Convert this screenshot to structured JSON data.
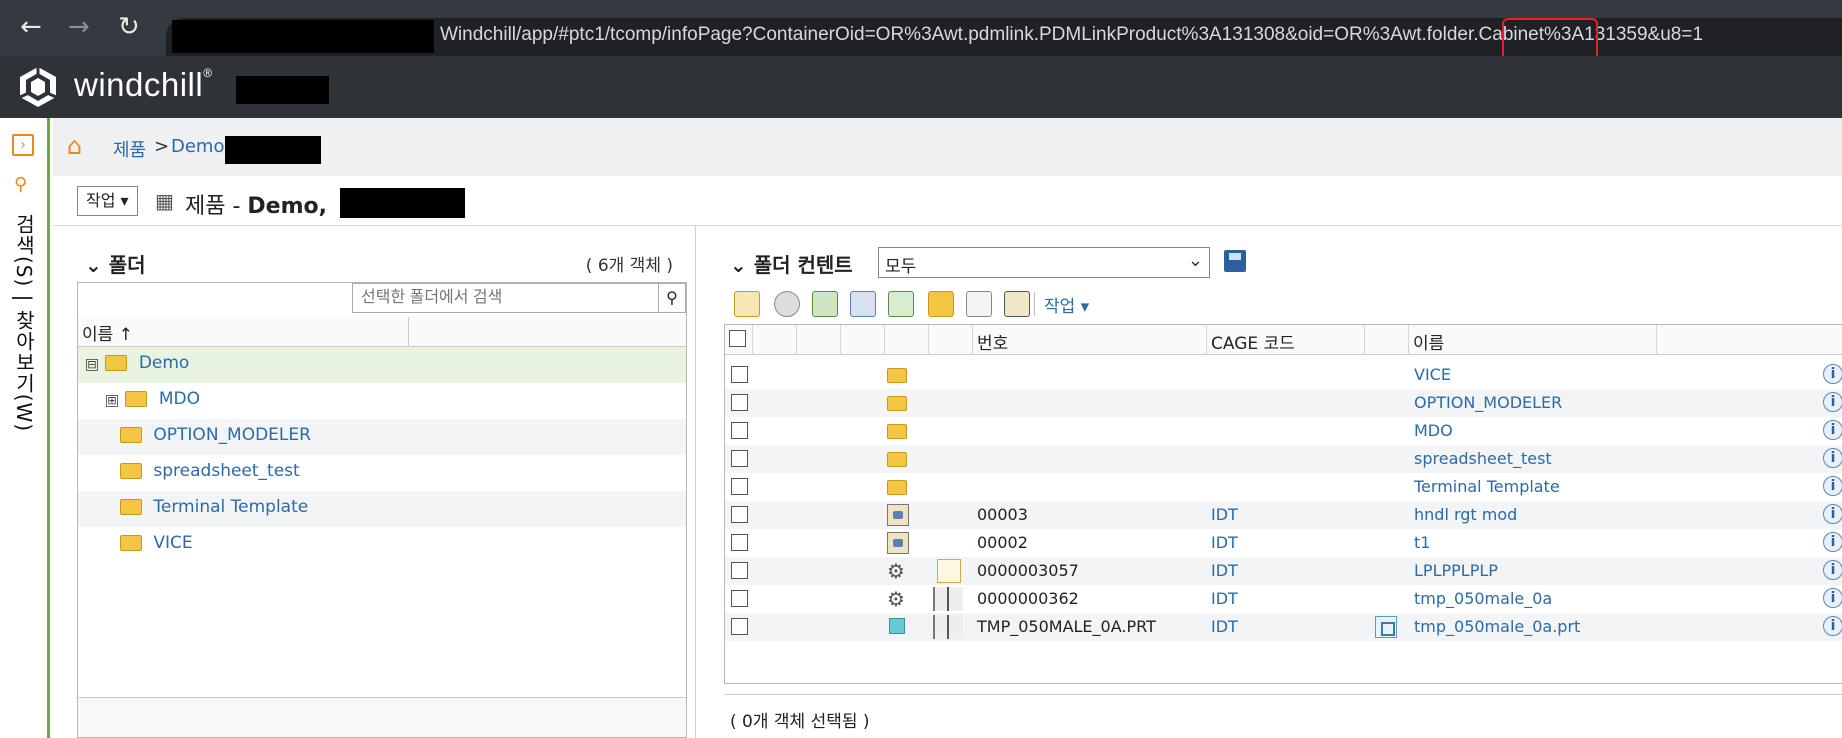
{
  "browser": {
    "back_icon": "arrow-left-icon",
    "forward_icon": "arrow-right-icon",
    "reload_icon": "reload-icon",
    "url_visible": "Windchill/app/#ptc1/tcomp/infoPage?ContainerOid=OR%3Awt.pdmlink.PDMLinkProduct%3A131308&oid=OR%3Awt.folder.Cabinet%3A131359&u8=1"
  },
  "app": {
    "brand": "windchill",
    "brand_mark": "®"
  },
  "left_nav": {
    "vertical_label": "검색(S) | 찾아보기(W)"
  },
  "breadcrumb": {
    "items": [
      "제품",
      "Demo,"
    ],
    "separator": ">"
  },
  "title_row": {
    "action_label": "작업 ▾",
    "title_prefix": "제품 - ",
    "title_bold": "Demo,"
  },
  "tree_panel": {
    "header": "폴더",
    "count": "( 6개 객체 )",
    "search_placeholder": "선택한 폴더에서 검색",
    "column_name": "이름 ↑",
    "rows": [
      {
        "label": "Demo",
        "expander": "⊟"
      },
      {
        "label": "MDO",
        "expander": "⊞"
      },
      {
        "label": "OPTION_MODELER",
        "expander": ""
      },
      {
        "label": "spreadsheet_test",
        "expander": ""
      },
      {
        "label": "Terminal Template",
        "expander": ""
      },
      {
        "label": "VICE",
        "expander": ""
      }
    ]
  },
  "content_panel": {
    "header": "폴더 컨텐트",
    "view_value": "모두",
    "toolbar_actions": "작업 ▾",
    "columns": {
      "number": "번호",
      "cage": "CAGE 코드",
      "name": "이름"
    },
    "rows": [
      {
        "type": "folder",
        "number": "",
        "cage": "",
        "name": "VICE"
      },
      {
        "type": "folder",
        "number": "",
        "cage": "",
        "name": "OPTION_MODELER"
      },
      {
        "type": "folder",
        "number": "",
        "cage": "",
        "name": "MDO"
      },
      {
        "type": "folder",
        "number": "",
        "cage": "",
        "name": "spreadsheet_test"
      },
      {
        "type": "folder",
        "number": "",
        "cage": "",
        "name": "Terminal Template"
      },
      {
        "type": "part",
        "number": "00003",
        "cage": "IDT",
        "name": "hndl rgt mod"
      },
      {
        "type": "part",
        "number": "00002",
        "cage": "IDT",
        "name": "t1"
      },
      {
        "type": "gear-doc",
        "number": "0000003057",
        "cage": "IDT",
        "name": "LPLPPLPLP"
      },
      {
        "type": "gear-bar",
        "number": "0000000362",
        "cage": "IDT",
        "name": "tmp_050male_0a"
      },
      {
        "type": "cube-bar",
        "number": "TMP_050MALE_0A.PRT",
        "cage": "IDT",
        "name": "tmp_050male_0a.prt"
      }
    ],
    "selection_status": "( 0개 객체 선택됨 )"
  },
  "colors": {
    "header_bg": "#2f3338",
    "accent_green": "#6ea83f",
    "link_blue": "#2c6aa8",
    "highlight_red": "#e8202a"
  }
}
